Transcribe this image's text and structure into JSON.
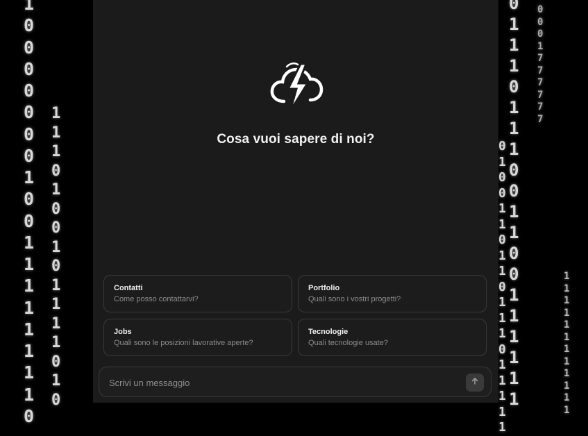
{
  "main": {
    "headline": "Cosa vuoi sapere di noi?"
  },
  "suggestions": [
    {
      "title": "Contatti",
      "subtitle": "Come posso contattarvi?"
    },
    {
      "title": "Portfolio",
      "subtitle": "Quali sono i vostri progetti?"
    },
    {
      "title": "Jobs",
      "subtitle": "Quali sono le posizioni lavorative aperte?"
    },
    {
      "title": "Tecnologie",
      "subtitle": "Quali tecnologie usate?"
    }
  ],
  "composer": {
    "placeholder": "Scrivi un messaggio",
    "send_icon": "arrow-up-icon"
  },
  "logo_icon": "cloud-lightning-icon",
  "colors": {
    "background": "#000000",
    "panel": "#1b1b1b",
    "card_border": "#3a3a3a",
    "text_primary": "#f2f2f2",
    "text_secondary": "#8c8c8c"
  }
}
